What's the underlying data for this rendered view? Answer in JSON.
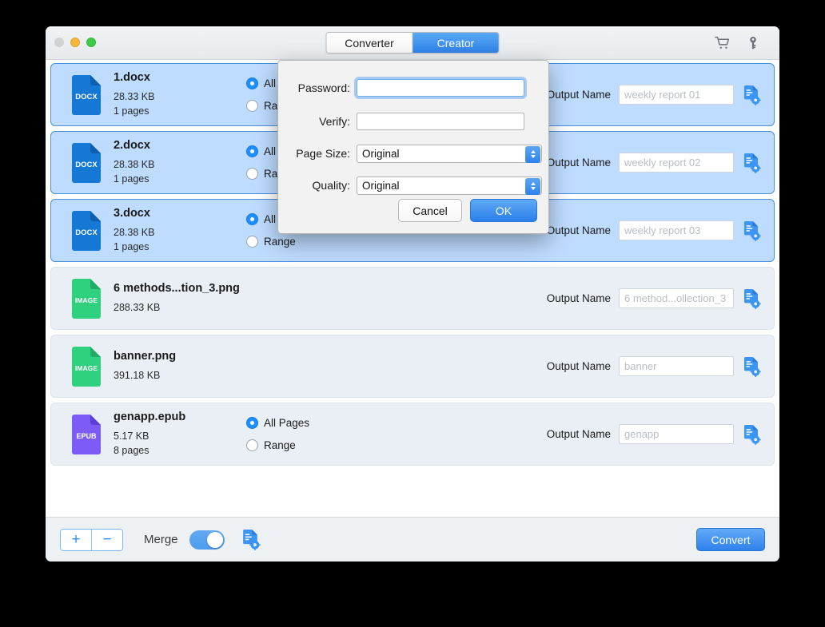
{
  "window": {
    "traffic_lights": [
      "close",
      "minimize",
      "zoom"
    ],
    "tabs": [
      {
        "label": "Converter",
        "active": false
      },
      {
        "label": "Creator",
        "active": true
      }
    ],
    "title_icons": [
      "cart-icon",
      "key-icon"
    ],
    "accent_color": "#2e82e8",
    "selected_row_color": "#bedcff",
    "unselected_row_color": "#eaeff5"
  },
  "files": [
    {
      "name": "1.docx",
      "size": "28.33 KB",
      "pages": "1 pages",
      "type": "DOCX",
      "icon": "docx-file-icon",
      "selected": true,
      "has_page_options": true,
      "page_option_all": "All Pages",
      "page_option_range": "Range",
      "page_option_selected": "all",
      "output_label": "Output Name",
      "output_placeholder": "weekly report 01",
      "output_value": ""
    },
    {
      "name": "2.docx",
      "size": "28.38 KB",
      "pages": "1 pages",
      "type": "DOCX",
      "icon": "docx-file-icon",
      "selected": true,
      "has_page_options": true,
      "page_option_all": "All Pages",
      "page_option_range": "Range",
      "page_option_selected": "all",
      "output_label": "Output Name",
      "output_placeholder": "weekly report 02",
      "output_value": ""
    },
    {
      "name": "3.docx",
      "size": "28.38 KB",
      "pages": "1 pages",
      "type": "DOCX",
      "icon": "docx-file-icon",
      "selected": true,
      "has_page_options": true,
      "page_option_all": "All Pages",
      "page_option_range": "Range",
      "page_option_selected": "all",
      "output_label": "Output Name",
      "output_placeholder": "weekly report 03",
      "output_value": ""
    },
    {
      "name": "6 methods...tion_3.png",
      "size": "288.33 KB",
      "pages": "",
      "type": "IMAGE",
      "icon": "image-file-icon",
      "selected": false,
      "has_page_options": false,
      "page_option_all": "",
      "page_option_range": "",
      "page_option_selected": "",
      "output_label": "Output Name",
      "output_placeholder": "6 method...ollection_3",
      "output_value": ""
    },
    {
      "name": "banner.png",
      "size": "391.18 KB",
      "pages": "",
      "type": "IMAGE",
      "icon": "image-file-icon",
      "selected": false,
      "has_page_options": false,
      "page_option_all": "",
      "page_option_range": "",
      "page_option_selected": "",
      "output_label": "Output Name",
      "output_placeholder": "banner",
      "output_value": ""
    },
    {
      "name": "genapp.epub",
      "size": "5.17 KB",
      "pages": "8 pages",
      "type": "EPUB",
      "icon": "epub-file-icon",
      "selected": false,
      "has_page_options": true,
      "page_option_all": "All Pages",
      "page_option_range": "Range",
      "page_option_selected": "all",
      "output_label": "Output Name",
      "output_placeholder": "genapp",
      "output_value": ""
    }
  ],
  "bottom_bar": {
    "add_label": "+",
    "remove_label": "−",
    "merge_label": "Merge",
    "merge_on": true,
    "settings_icon": "document-settings-icon",
    "convert_label": "Convert"
  },
  "dialog": {
    "password_label": "Password:",
    "password_value": "",
    "password_focused": true,
    "verify_label": "Verify:",
    "verify_value": "",
    "page_size_label": "Page Size:",
    "page_size_value": "Original",
    "quality_label": "Quality:",
    "quality_value": "Original",
    "cancel_label": "Cancel",
    "ok_label": "OK"
  }
}
